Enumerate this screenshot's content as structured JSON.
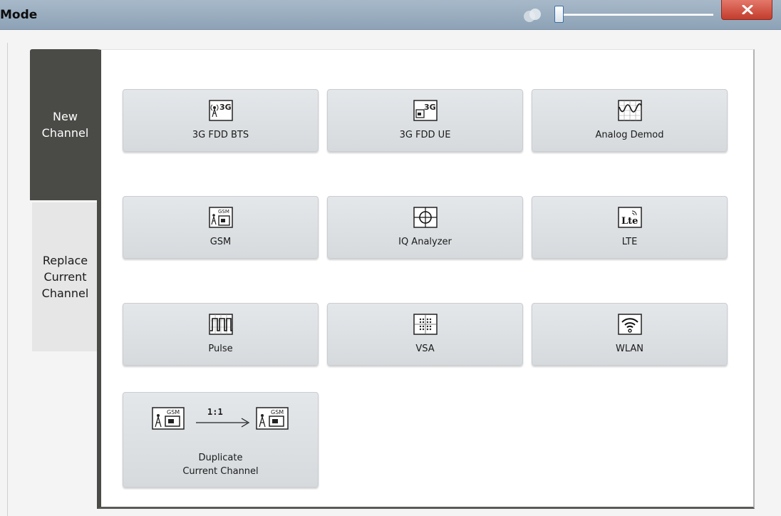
{
  "window": {
    "title": "Mode",
    "close_label": "x"
  },
  "tabs": {
    "new_channel": [
      "New",
      "Channel"
    ],
    "replace_current_channel": [
      "Replace",
      "Current",
      "Channel"
    ]
  },
  "modes": [
    {
      "label": "3G FDD BTS",
      "icon": "3g-fdd-bts-icon",
      "icon_text": "3G"
    },
    {
      "label": "3G FDD UE",
      "icon": "3g-fdd-ue-icon",
      "icon_text": "3G"
    },
    {
      "label": "Analog Demod",
      "icon": "analog-demod-icon"
    },
    {
      "label": "GSM",
      "icon": "gsm-icon",
      "icon_text": "GSM"
    },
    {
      "label": "IQ Analyzer",
      "icon": "iq-analyzer-icon"
    },
    {
      "label": "LTE",
      "icon": "lte-icon",
      "icon_text": "Lte"
    },
    {
      "label": "Pulse",
      "icon": "pulse-icon"
    },
    {
      "label": "VSA",
      "icon": "vsa-icon"
    },
    {
      "label": "WLAN",
      "icon": "wlan-icon"
    }
  ],
  "duplicate": {
    "ratio": "1:1",
    "label_lines": [
      "Duplicate",
      "Current Channel"
    ],
    "icon_text": "GSM"
  },
  "colors": {
    "active_tab": "#4a4a47",
    "inactive_tab": "#e6e6e6",
    "button_face": "#dcdfe2",
    "close_button": "#d04a38",
    "title_bar": "#9aaec0"
  }
}
